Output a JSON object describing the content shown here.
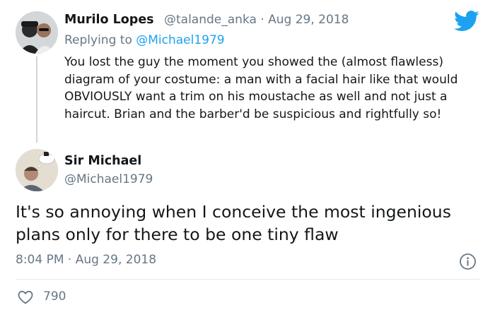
{
  "reply": {
    "author_name": "Murilo Lopes",
    "author_handle": "@talande_anka",
    "separator": "·",
    "date": "Aug 29, 2018",
    "replying_prefix": "Replying to",
    "replying_handle": "@Michael1979",
    "text": "You lost the guy the moment you showed the (almost flawless) diagram of your costume: a man with a facial hair like that would OBVIOUSLY want a trim on his moustache as well and not just a haircut. Brian and the barber'd be suspicious and rightfully so!"
  },
  "tweet": {
    "author_name": "Sir Michael",
    "author_handle": "@Michael1979",
    "text": "It's so annoying when I conceive the most ingenious plans only for there to be one tiny flaw",
    "timestamp": "8:04 PM · Aug 29, 2018",
    "like_count": "790"
  },
  "icons": {
    "brand": "twitter-bird-icon",
    "info": "info-icon",
    "like": "heart-icon"
  },
  "colors": {
    "brand_blue": "#1da1f2",
    "secondary_text": "#657786",
    "primary_text": "#14171a",
    "divider": "#e1e8ed"
  }
}
